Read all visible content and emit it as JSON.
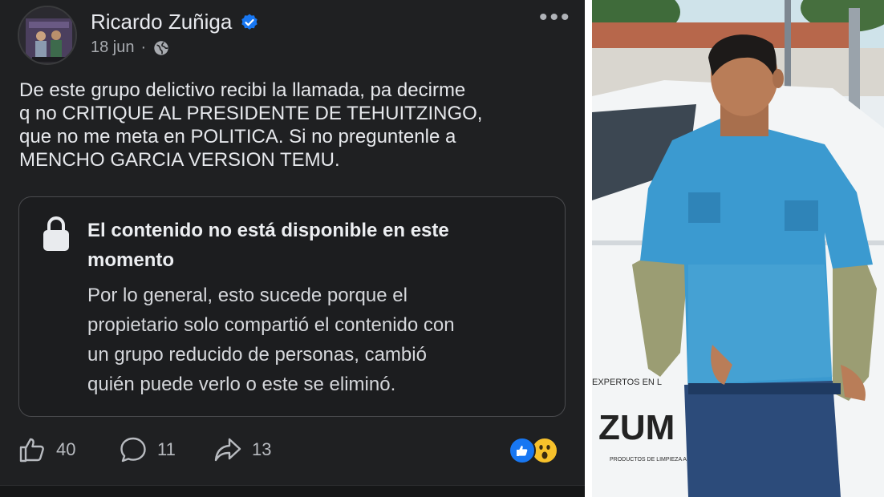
{
  "post": {
    "author": "Ricardo Zuñiga",
    "date": "18 jun",
    "separator": "·",
    "more_label": "•••",
    "text_lines": [
      "De este grupo delictivo recibi la llamada, pa decirme",
      "q no CRITIQUE AL PRESIDENTE DE TEHUITZINGO,",
      "que no me meta en POLITICA. Si no preguntenle a",
      "MENCHO GARCIA VERSION TEMU."
    ],
    "unavailable": {
      "title_lines": [
        "El contenido no está disponible en este",
        "momento"
      ],
      "body_lines": [
        "Por lo general, esto sucede porque el",
        "propietario solo compartió el contenido con",
        "un grupo reducido de personas, cambió",
        "quién puede verlo o este se eliminó."
      ]
    },
    "stats": {
      "likes": "40",
      "comments": "11",
      "shares": "13"
    },
    "reactions": [
      "like-icon",
      "wow-icon"
    ]
  },
  "photo": {
    "banner_text": "EXPERTOS EN L",
    "logo_text": "ZUM",
    "tagline": "PRODUCTOS DE LIMPIEZA A"
  },
  "colors": {
    "post_bg": "#1f2022",
    "text": "#e4e6eb",
    "muted": "#a8abb0",
    "verified": "#1877f2",
    "shirt": "#3b9ad0"
  }
}
